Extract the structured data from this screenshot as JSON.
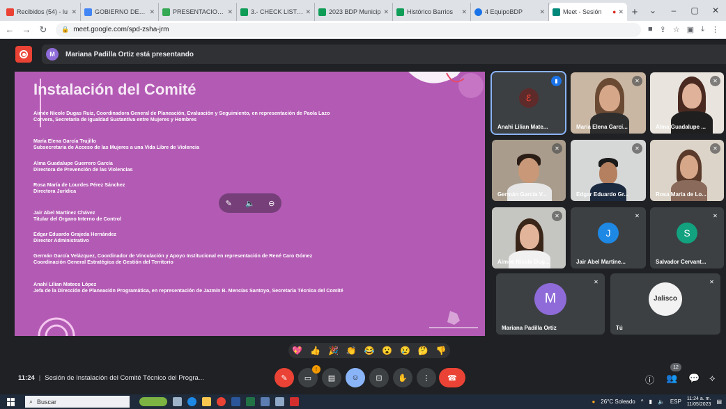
{
  "browser": {
    "tabs": [
      {
        "title": "Recibidos (54) - lu",
        "color": "#ea4335"
      },
      {
        "title": "GOBIERNO DEL EI",
        "color": "#4285f4"
      },
      {
        "title": "PRESENTACIONES",
        "color": "#34a853"
      },
      {
        "title": "3.- CHECK LIST_FI",
        "color": "#0f9d58"
      },
      {
        "title": "2023 BDP Municip",
        "color": "#0f9d58"
      },
      {
        "title": "Histórico Barrios",
        "color": "#0f9d58"
      },
      {
        "title": "4 EquipoBDP",
        "color": "#1a73e8"
      },
      {
        "title": "Meet - Sesión",
        "color": "#00897b"
      }
    ],
    "url": "meet.google.com/spd-zsha-jrm"
  },
  "meet": {
    "presenter_initial": "M",
    "presenting_text": "Mariana Padilla Ortiz está presentando",
    "time": "11:24",
    "meeting_title": "Sesión de Instalación del Comité Técnico del Progra...",
    "participant_count": "12"
  },
  "slide": {
    "title": "Instalación del Comité",
    "blocks": [
      {
        "line1": "Aimée Nicole Dugas Ruiz, Coordinadora General de Planeación, Evaluación y Seguimiento, en representación de Paola Lazo",
        "line2": "Corvera, Secretaria de Igualdad Sustantiva entre Mujeres y Hombres"
      },
      {
        "line1": "María Elena García Trujillo",
        "line2": "Subsecretaria de Acceso de las Mujeres a una Vida Libre de Violencia"
      },
      {
        "line1": "Alma Guadalupe Guerrero García",
        "line2": "Directora de  Prevención de las Violencias"
      },
      {
        "line1": "Rosa María de Lourdes Pérez Sánchez",
        "line2": "Directora Jurídica"
      },
      {
        "line1": "Jair Abel Martínez Chávez",
        "line2": "Titular del Órgano Interno de Control"
      },
      {
        "line1": "Edgar Eduardo Grajeda Hernández",
        "line2": "Director Administrativo"
      },
      {
        "line1": " Germán García Velázquez, Coordinador de Vinculación y Apoyo Institucional en representación de René Caro  Gómez",
        "line2": "Coordinación General Estratégica de Gestión del Territorio"
      },
      {
        "line1": "Anahí  Lilian Mateos López",
        "line2": "Jefa de la Dirección de Planeación Programática, en representación de Jazmín B. Mencías Santoyo, Secretaria Técnica del Comité"
      }
    ]
  },
  "participants": [
    {
      "name": "Anahi Lilian Mate...",
      "type": "logo"
    },
    {
      "name": "María Elena Garcí...",
      "type": "video"
    },
    {
      "name": "Alma Guadalupe ...",
      "type": "video"
    },
    {
      "name": "Germán García V...",
      "type": "video"
    },
    {
      "name": "Edgar Eduardo Gr...",
      "type": "video"
    },
    {
      "name": "Rosa María de Lo...",
      "type": "video"
    },
    {
      "name": "Aimee Nicole Dug...",
      "type": "video"
    },
    {
      "name": "Jair Abel Martine...",
      "type": "avatar",
      "initial": "J",
      "color": "#1e88e5"
    },
    {
      "name": "Salvador Cervant...",
      "type": "avatar",
      "initial": "S",
      "color": "#12a27f"
    },
    {
      "name": "Mariana Padilla Ortiz",
      "type": "avatar",
      "initial": "M",
      "color": "#8e6bd8"
    },
    {
      "name": "Tú",
      "type": "logo_jalisco",
      "logo_text": "Jalisco"
    }
  ],
  "reactions": [
    "💖",
    "👍",
    "🎉",
    "👏",
    "😂",
    "😮",
    "😢",
    "🤔",
    "👎"
  ],
  "taskbar": {
    "search_placeholder": "Buscar",
    "weather": "26°C  Soleado",
    "lang": "ESP",
    "clock_time": "11:24 a. m.",
    "clock_date": "11/05/2023"
  }
}
